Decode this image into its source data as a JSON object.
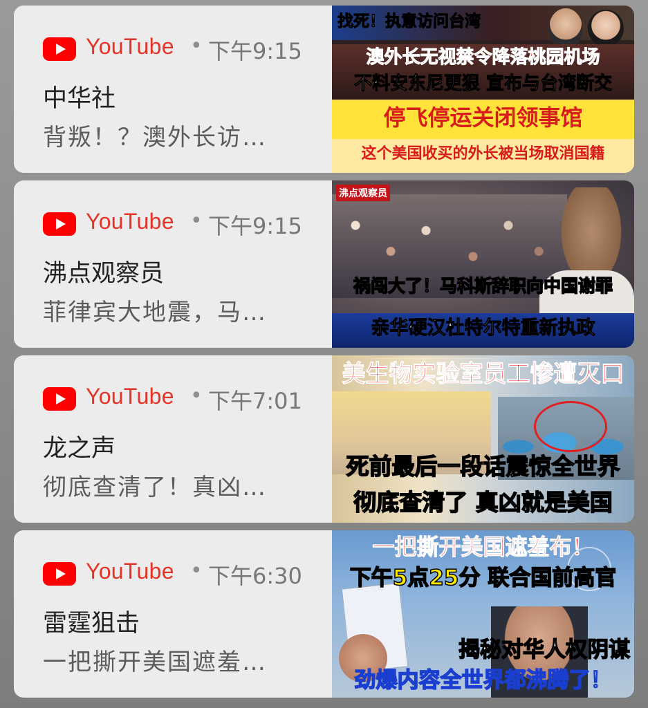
{
  "notifications": [
    {
      "app": "YouTube",
      "time": "下午9:15",
      "channel": "中华社",
      "snippet": "背叛！？澳外长访…",
      "thumb_caption": [
        "找死！执意访问台湾",
        "澳外长无视禁令降落桃园机场",
        "不料安东尼更狠 宣布与台湾断交",
        "停飞停运关闭领事馆",
        "这个美国收买的外长被当场取消国籍"
      ]
    },
    {
      "app": "YouTube",
      "time": "下午9:15",
      "channel": "沸点观察员",
      "snippet": "菲律宾大地震，马…",
      "thumb_caption": [
        "沸点观察员",
        "祸闯大了！马科斯辞职向中国谢罪",
        "亲华硬汉杜特尔特重新执政"
      ]
    },
    {
      "app": "YouTube",
      "time": "下午7:01",
      "channel": "龙之声",
      "snippet": "彻底查清了！真凶…",
      "thumb_caption": [
        "美生物实验室员工惨遭灭口",
        "死前最后一段话震惊全世界",
        "彻底查清了 真凶就是美国"
      ]
    },
    {
      "app": "YouTube",
      "time": "下午6:30",
      "channel": "雷霆狙击",
      "snippet": "一把撕开美国遮羞…",
      "thumb_caption": [
        "一把撕开美国遮羞布！",
        "下午5点25分 联合国前高官",
        "揭秘对华人权阴谋",
        "劲爆内容全世界都沸腾了！"
      ]
    }
  ],
  "colors": {
    "youtube_red": "#ff0000",
    "card_bg": "#ececec"
  }
}
